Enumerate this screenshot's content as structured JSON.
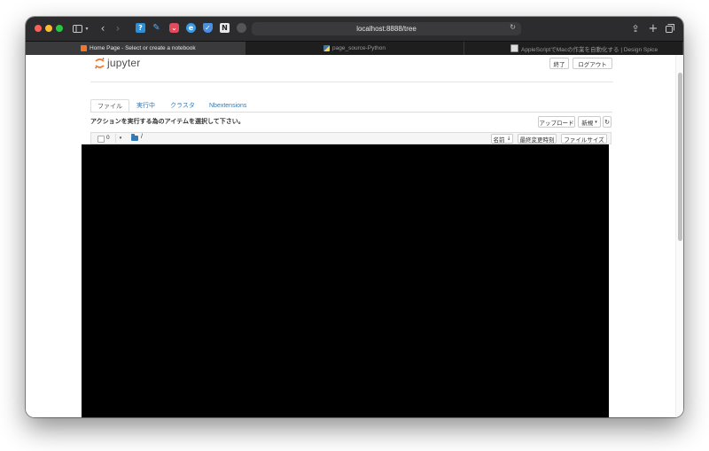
{
  "browser": {
    "url": "localhost:8888/tree",
    "tabs": [
      {
        "label": "Home Page - Select or create a notebook",
        "active": true
      },
      {
        "label": "page_source-Python",
        "active": false
      },
      {
        "label": "AppleScriptでMacの作業を自動化する | Design Spice",
        "active": false
      }
    ]
  },
  "header": {
    "logo_text": "jupyter",
    "quit_label": "終了",
    "logout_label": "ログアウト"
  },
  "nav_tabs": {
    "files": "ファイル",
    "running": "実行中",
    "clusters": "クラスタ",
    "nbextensions": "Nbextensions"
  },
  "toolbar": {
    "action_text": "アクションを実行する為のアイテムを選択して下さい。",
    "upload_label": "アップロード",
    "new_label": "新規",
    "new_caret": "▾",
    "refresh_icon": "↻"
  },
  "list_header": {
    "selected_count": "0",
    "caret": "▾",
    "breadcrumb": "/",
    "name_col": "名前",
    "sort_arrow": "🡫",
    "modified_col": "最終変更時刻",
    "size_col": "ファイルサイズ"
  },
  "colors": {
    "link": "#337ab7",
    "jupyter_orange": "#f37726"
  }
}
